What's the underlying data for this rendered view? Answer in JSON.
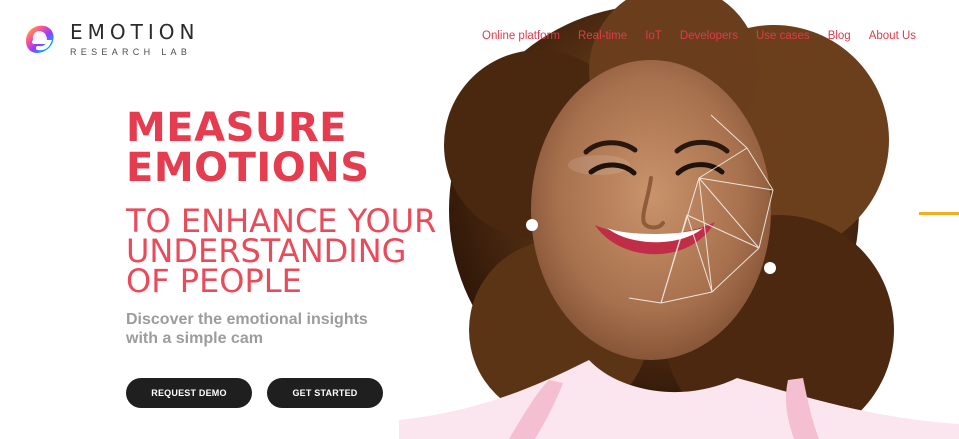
{
  "brand": {
    "title": "EMOTION",
    "subtitle": "RESEARCH LAB"
  },
  "nav": {
    "items": [
      "Online platform",
      "Real-time",
      "IoT",
      "Developers",
      "Use cases",
      "Blog",
      "About Us"
    ]
  },
  "hero": {
    "headline_line1": "MEASURE",
    "headline_line2": "EMOTIONS",
    "subheadline_line1": "TO ENHANCE YOUR",
    "subheadline_line2": "UNDERSTANDING",
    "subheadline_line3": "OF PEOPLE",
    "description_line1": "Discover the emotional insights",
    "description_line2": "with a simple cam",
    "request_demo": "REQUEST DEMO",
    "get_started": "GET STARTED"
  },
  "colors": {
    "primary": "#e53d4f",
    "button": "#1f1f1f",
    "accent": "#f2b01e"
  },
  "icons": {
    "logo": "emotion-research-lab-logo-icon"
  }
}
